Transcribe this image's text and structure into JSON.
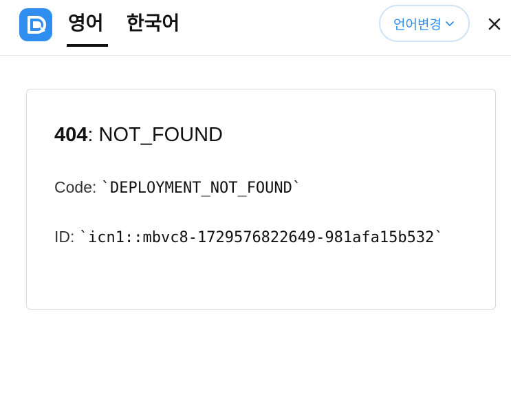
{
  "header": {
    "tabs": [
      {
        "label": "영어",
        "active": true
      },
      {
        "label": "한국어",
        "active": false
      }
    ],
    "language_button": {
      "label": "언어변경",
      "icon": "chevron-down-icon"
    },
    "close_icon": "close-icon",
    "logo_icon": "translate-app-logo-icon"
  },
  "error": {
    "status": "404",
    "separator": ": ",
    "message": "NOT_FOUND",
    "code_label": "Code: ",
    "code_value": "`DEPLOYMENT_NOT_FOUND`",
    "id_label": "ID: ",
    "id_value": "`icn1::mbvc8-1729576822649-981afa15b532`"
  },
  "colors": {
    "accent": "#2f8ef0",
    "button_border": "#cfe3f6",
    "card_border": "#d9d9d9",
    "text": "#111111"
  }
}
